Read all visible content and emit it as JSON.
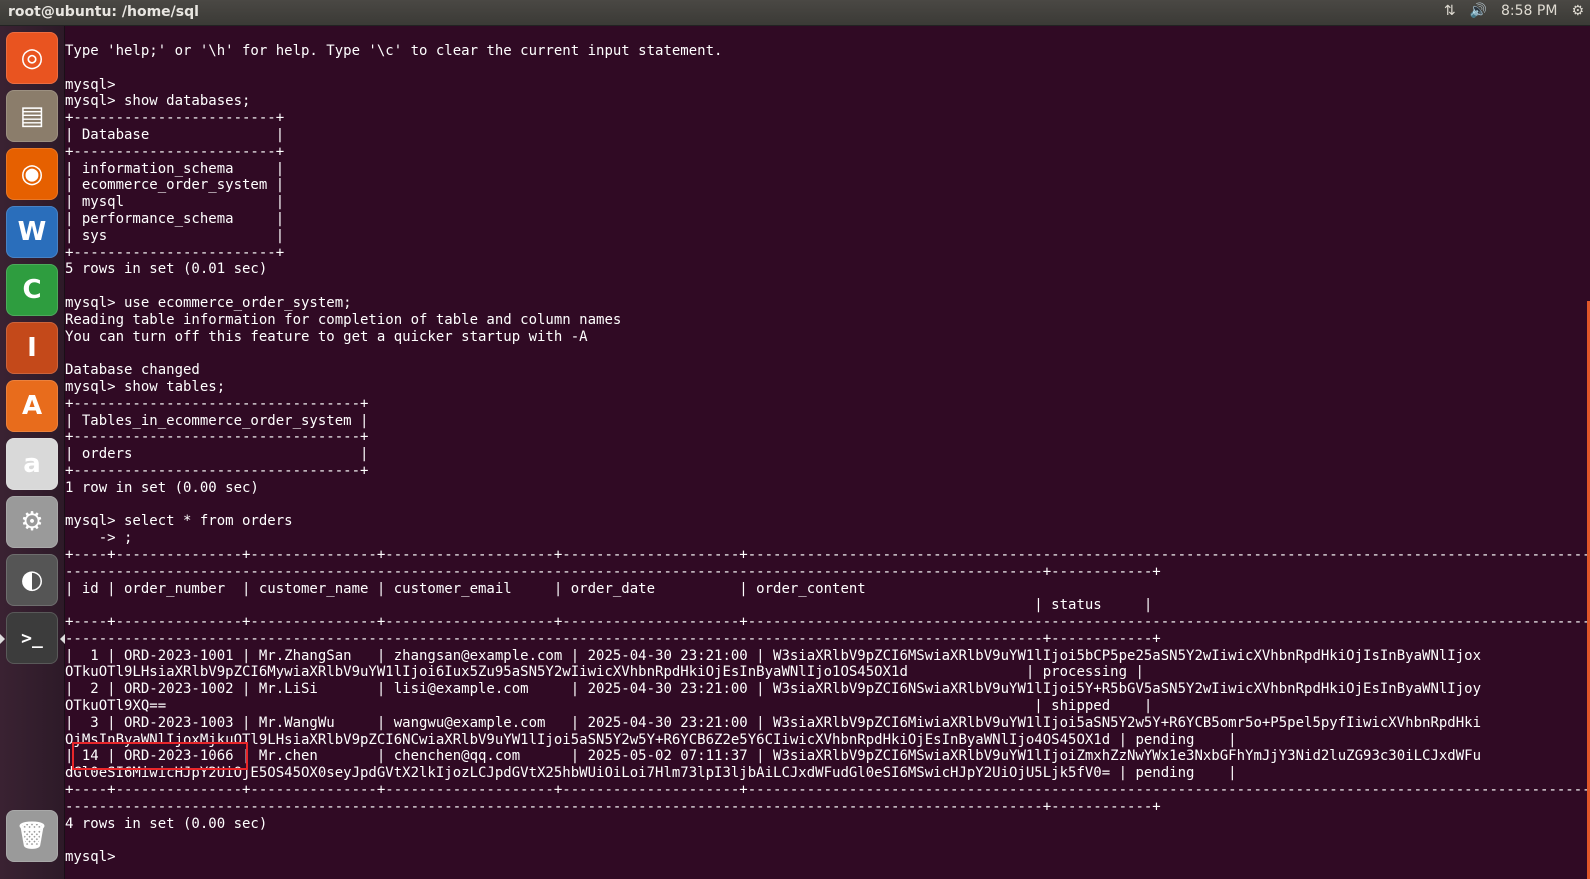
{
  "topbar": {
    "title": "root@ubuntu: /home/sql",
    "time": "8:58 PM",
    "network_icon": "⇅",
    "volume_icon": "🔊",
    "settings_icon": "⚙"
  },
  "launcher": {
    "items": [
      {
        "name": "ubuntu-dash-icon",
        "glyph": "◎",
        "color": "#e95420"
      },
      {
        "name": "files-icon",
        "glyph": "▤",
        "color": "#8b7d6b"
      },
      {
        "name": "firefox-icon",
        "glyph": "◉",
        "color": "#e66000"
      },
      {
        "name": "writer-icon",
        "glyph": "W",
        "color": "#2a6ebb"
      },
      {
        "name": "calc-icon",
        "glyph": "C",
        "color": "#2e9d3f"
      },
      {
        "name": "impress-icon",
        "glyph": "I",
        "color": "#c4491a"
      },
      {
        "name": "software-center-icon",
        "glyph": "A",
        "color": "#e86c1c"
      },
      {
        "name": "amazon-icon",
        "glyph": "a",
        "color": "#d9d9d9"
      },
      {
        "name": "system-settings-icon",
        "glyph": "⚙",
        "color": "#9a9a9a"
      },
      {
        "name": "disk-icon",
        "glyph": "◐",
        "color": "#555555"
      },
      {
        "name": "terminal-icon",
        "glyph": ">_",
        "color": "#3c3c3c"
      },
      {
        "name": "trash-icon",
        "glyph": "🗑",
        "color": "#9a9a9a"
      }
    ]
  },
  "terminal": {
    "lines": [
      "Type 'help;' or '\\h' for help. Type '\\c' to clear the current input statement.",
      "",
      "mysql>",
      "mysql> show databases;",
      "+------------------------+",
      "| Database               |",
      "+------------------------+",
      "| information_schema     |",
      "| ecommerce_order_system |",
      "| mysql                  |",
      "| performance_schema     |",
      "| sys                    |",
      "+------------------------+",
      "5 rows in set (0.01 sec)",
      "",
      "mysql> use ecommerce_order_system;",
      "Reading table information for completion of table and column names",
      "You can turn off this feature to get a quicker startup with -A",
      "",
      "Database changed",
      "mysql> show tables;",
      "+----------------------------------+",
      "| Tables_in_ecommerce_order_system |",
      "+----------------------------------+",
      "| orders                           |",
      "+----------------------------------+",
      "1 row in set (0.00 sec)",
      "",
      "mysql> select * from orders",
      "    -> ;",
      "+----+---------------+---------------+--------------------+---------------------+-----------------------------------------------------------------------------------------------------------------------------------------------------------------------------------------------------------",
      "--------------------------------------------------------------------------------------------------------------------+------------+",
      "| id | order_number  | customer_name | customer_email     | order_date          | order_content",
      "                                                                                                                   | status     |",
      "+----+---------------+---------------+--------------------+---------------------+-----------------------------------------------------------------------------------------------------------------------------------------------------------------------------------------------------------",
      "--------------------------------------------------------------------------------------------------------------------+------------+",
      "|  1 | ORD-2023-1001 | Mr.ZhangSan   | zhangsan@example.com | 2025-04-30 23:21:00 | W3siaXRlbV9pZCI6MSwiaXRlbV9uYW1lIjoi5bCP5pe25aSN5Y2wIiwicXVhbnRpdHkiOjIsInByaWNlIjox",
      "OTkuOTl9LHsiaXRlbV9pZCI6MywiaXRlbV9uYW1lIjoi6Iux5Zu95aSN5Y2wIiwicXVhbnRpdHkiOjEsInByaWNlIjo1OS45OX1d              | processing |",
      "|  2 | ORD-2023-1002 | Mr.LiSi       | lisi@example.com     | 2025-04-30 23:21:00 | W3siaXRlbV9pZCI6NSwiaXRlbV9uYW1lIjoi5Y+R5bGV5aSN5Y2wIiwicXVhbnRpdHkiOjEsInByaWNlIjoy",
      "OTkuOTl9XQ==                                                                                                       | shipped    |",
      "|  3 | ORD-2023-1003 | Mr.WangWu     | wangwu@example.com   | 2025-04-30 23:21:00 | W3siaXRlbV9pZCI6MiwiaXRlbV9uYW1lIjoi5aSN5Y2w5Y+R6YCB5omr5o+P5pel5pyfIiwicXVhbnRpdHki",
      "OjMsInByaWNlIjoxMjkuOTl9LHsiaXRlbV9pZCI6NCwiaXRlbV9uYW1lIjoi5aSN5Y2w5Y+R6YCB6Z2e5Y6CIiwicXVhbnRpdHkiOjEsInByaWNlIjo4OS45OX1d | pending    |",
      "| 14 | ORD-2023-1066 | Mr.chen       | chenchen@qq.com      | 2025-05-02 07:11:37 | W3siaXRlbV9pZCI6MSwiaXRlbV9uYW1lIjoiZmxhZzNwYWx1e3NxbGFhYmJjY3Nid2luZG93c30iLCJxdWFu",
      "dGl0eSI6MiwicHJpY2UiOjE5OS45OX0seyJpdGVtX2lkIjozLCJpdGVtX25hbWUiOiLoi7Hlm73lpI3ljbAiLCJxdWFudGl0eSI6MSwicHJpY2UiOjU5Ljk5fV0= | pending    |",
      "+----+---------------+---------------+--------------------+---------------------+-----------------------------------------------------------------------------------------------------------------------------------------------------------------------------------------------------------",
      "--------------------------------------------------------------------------------------------------------------------+------------+",
      "4 rows in set (0.00 sec)",
      "",
      "mysql> "
    ]
  }
}
